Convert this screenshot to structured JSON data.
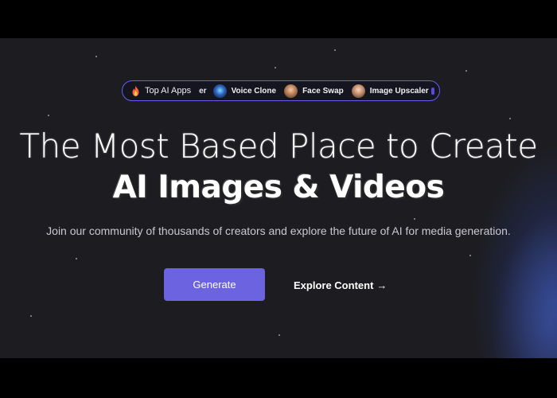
{
  "apps_bar": {
    "top_label": "Top AI Apps",
    "cut_fragment": "er",
    "items": [
      {
        "label": "Voice Clone",
        "icon": "voice-clone-avatar"
      },
      {
        "label": "Face Swap",
        "icon": "face-swap-avatar"
      },
      {
        "label": "Image Upscaler",
        "icon": "image-upscaler-avatar"
      }
    ],
    "accent_color": "#6a5cf0"
  },
  "hero": {
    "title_line1": "The Most Based Place to Create",
    "title_line2": "AI Images & Videos",
    "subtitle": "Join our community of thousands of creators and explore the future of AI for media generation."
  },
  "actions": {
    "generate_label": "Generate",
    "explore_label": "Explore Content",
    "explore_arrow": "→",
    "primary_color": "#6c63e0"
  }
}
